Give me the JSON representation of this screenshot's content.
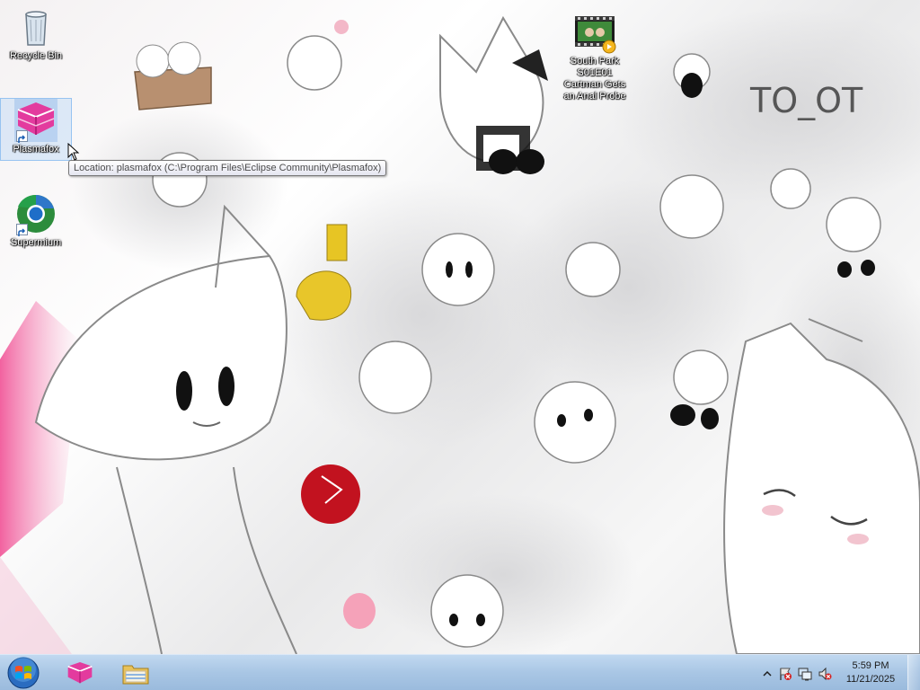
{
  "desktop": {
    "icons": {
      "recycle_bin": {
        "label": "Recycle Bin",
        "icon": "recycle-bin-icon"
      },
      "plasmafox": {
        "label": "Plasmafox",
        "icon": "plasmafox-icon"
      },
      "supermium": {
        "label": "Supermium",
        "icon": "supermium-icon"
      },
      "south_park": {
        "label": "South Park\nS01E01\nCartman Gets\nan Anal Probe",
        "icon": "video-file-icon"
      }
    },
    "tooltip": "Location: plasmafox (C:\\Program Files\\Eclipse Community\\Plasmafox)"
  },
  "taskbar": {
    "start_icon": "windows-start-orb-icon",
    "pinned": [
      {
        "name": "Plasmafox",
        "icon": "plasmafox-icon"
      },
      {
        "name": "Windows Explorer",
        "icon": "folder-icon"
      }
    ],
    "tray": {
      "icons": [
        "show-hidden-icons-chevron",
        "action-center-flag-icon",
        "network-icon",
        "volume-muted-icon"
      ],
      "time": "5:59 PM",
      "date": "11/21/2025"
    }
  },
  "colors": {
    "plasmafox_pink": "#e33b9e",
    "taskbar": "#a9c6e6"
  }
}
